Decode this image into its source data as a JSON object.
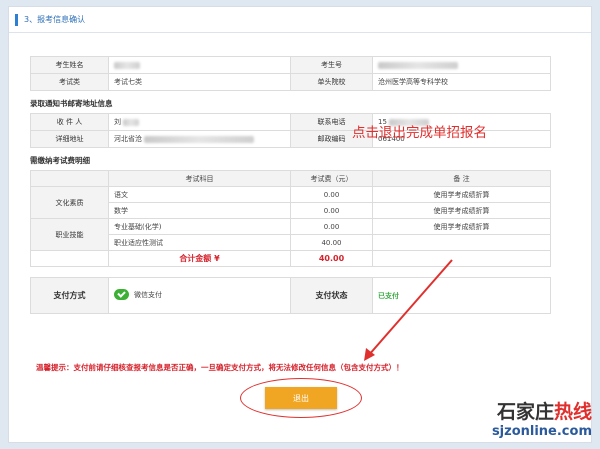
{
  "header": {
    "title": "3、报考信息确认"
  },
  "annotation": "点击退出完成单招报名",
  "exam_info": {
    "name_label": "考生姓名",
    "number_label": "考生号",
    "category_label": "考试类",
    "category_value": "考试七类",
    "school_label": "单头院校",
    "school_value": "沧州医学高等专科学校"
  },
  "mail_info": {
    "section_title": "录取通知书邮寄地址信息",
    "receiver_label": "收 件 人",
    "receiver_value": "刘",
    "phone_label": "联系电话",
    "phone_value": "15",
    "address_label": "详细地址",
    "address_value": "河北省沧",
    "zip_label": "邮政编码",
    "zip_value": "061400"
  },
  "fee_info": {
    "section_title": "需缴纳考试费明细",
    "headers": [
      "考试科目",
      "考试费（元）",
      "备 注"
    ],
    "group_culture": "文化素质",
    "group_skill": "职业技能",
    "rows": [
      {
        "subject": "语文",
        "fee": "0.00",
        "note": "使用学考成绩折算"
      },
      {
        "subject": "数学",
        "fee": "0.00",
        "note": "使用学考成绩折算"
      },
      {
        "subject": "专业基础(化学)",
        "fee": "0.00",
        "note": "使用学考成绩折算"
      },
      {
        "subject": "职业适应性测试",
        "fee": "40.00",
        "note": ""
      }
    ],
    "total_label": "合计金额 ¥",
    "total_value": "40.00"
  },
  "payment": {
    "method_label": "支付方式",
    "method_value": "微信支付",
    "status_label": "支付状态",
    "status_value": "已支付"
  },
  "warning": "温馨提示：支付前请仔细核查报考信息是否正确，一旦确定支付方式，将无法修改任何信息（包含支付方式）！",
  "exit_button": "退出",
  "watermark": {
    "brand_a": "石家庄",
    "brand_b": "热线",
    "url": "sjzonline.com"
  },
  "colors": {
    "accent": "#2d7fd3",
    "warning": "#d6232d",
    "button": "#f0a623",
    "paid": "#3aa845"
  }
}
